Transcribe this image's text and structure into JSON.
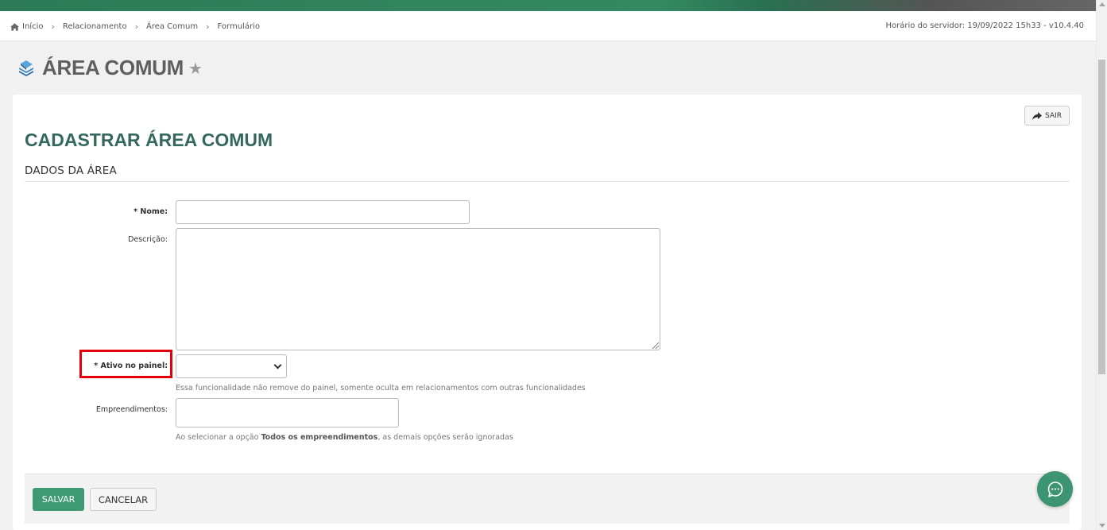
{
  "breadcrumb": {
    "items": [
      "Início",
      "Relacionamento",
      "Área Comum",
      "Formulário"
    ]
  },
  "server_time": "Horário do servidor: 19/09/2022 15h33 - v10.4.40",
  "page_title": "ÁREA COMUM",
  "exit_button": "SAIR",
  "form_title": "CADASTRAR ÁREA COMUM",
  "section_title": "DADOS DA ÁREA",
  "fields": {
    "nome": {
      "label": "* Nome:",
      "value": ""
    },
    "descricao": {
      "label": "Descrição:",
      "value": ""
    },
    "ativo": {
      "label": "* Ativo no painel:",
      "selected": "",
      "help": "Essa funcionalidade não remove do painel, somente oculta em relacionamentos com outras funcionalidades"
    },
    "empreendimentos": {
      "label": "Empreendimentos:",
      "help_prefix": "Ao selecionar a opção ",
      "help_bold": "Todos os empreendimentos",
      "help_suffix": ", as demais opções serão ignoradas"
    }
  },
  "buttons": {
    "save": "SALVAR",
    "cancel": "CANCELAR"
  },
  "icons": {
    "home": "home-icon",
    "breadcrumb_sep": "chevron-right-icon",
    "page": "stack-icon",
    "favorite": "star-icon",
    "exit": "share-arrow-icon",
    "chat": "chat-bubble-icon"
  },
  "colors": {
    "brand": "#3e9a73",
    "form_title": "#35685e",
    "highlight": "#e3000b"
  }
}
